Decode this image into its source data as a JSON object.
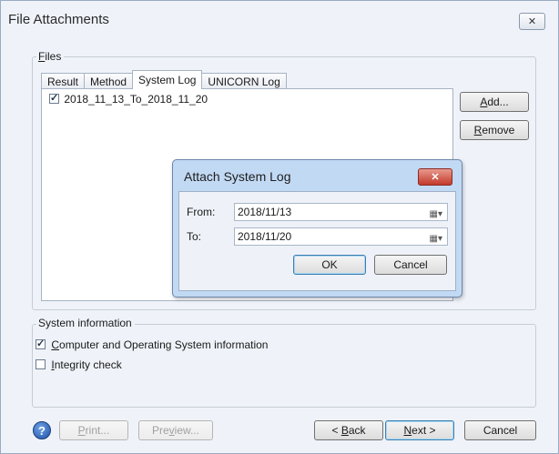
{
  "window": {
    "title": "File Attachments",
    "close_glyph": "✕"
  },
  "files_group": {
    "label_pre": "",
    "label_accel": "F",
    "label_post": "iles",
    "tabs": [
      {
        "label": "Result",
        "active": false
      },
      {
        "label": "Method",
        "active": false
      },
      {
        "label": "System Log",
        "active": true
      },
      {
        "label": "UNICORN Log",
        "active": false
      }
    ],
    "items": [
      {
        "label": "2018_11_13_To_2018_11_20",
        "checked": true
      }
    ],
    "add_button": {
      "accel": "A",
      "rest": "dd..."
    },
    "remove_button": {
      "accel": "R",
      "rest": "emove"
    }
  },
  "dialog": {
    "title": "Attach System Log",
    "close_glyph": "✕",
    "from_label": "From:",
    "from_value": "2018/11/13",
    "to_label": "To:",
    "to_value": "2018/11/20",
    "ok_label": "OK",
    "cancel_label": "Cancel",
    "calendar_glyph": "▦▾"
  },
  "sysinfo_group": {
    "label": "System information",
    "computer_info": {
      "accel": "C",
      "rest": "omputer and Operating System information",
      "checked": true
    },
    "integrity": {
      "accel": "I",
      "rest": "ntegrity check",
      "checked": false
    }
  },
  "footer": {
    "help_glyph": "?",
    "print": {
      "accel": "P",
      "rest": "rint..."
    },
    "preview": {
      "pre": "Pre",
      "accel": "v",
      "rest": "iew..."
    },
    "back": {
      "pre": "< ",
      "accel": "B",
      "rest": "ack"
    },
    "next": {
      "accel": "N",
      "rest": "ext >"
    },
    "cancel_label": "Cancel"
  }
}
